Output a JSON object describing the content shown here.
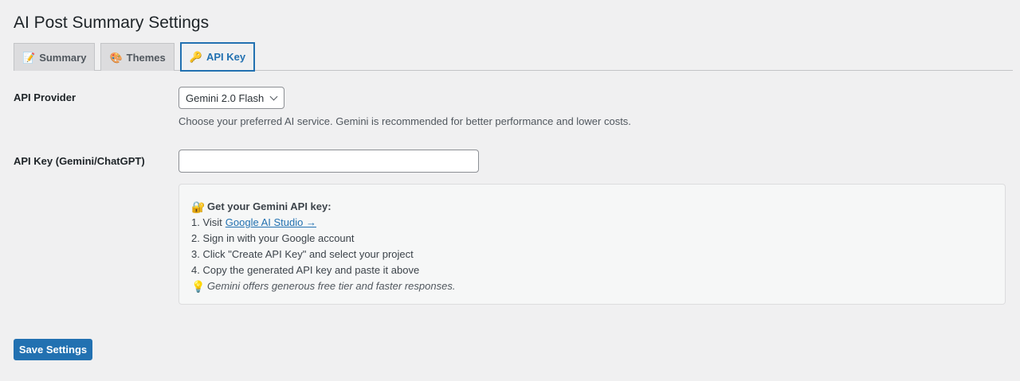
{
  "page": {
    "title": "AI Post Summary Settings"
  },
  "tabs": [
    {
      "label": "Summary",
      "icon": "📝",
      "icon_name": "memo-icon",
      "active": false
    },
    {
      "label": "Themes",
      "icon": "🎨",
      "icon_name": "palette-icon",
      "active": false
    },
    {
      "label": "API Key",
      "icon": "🔑",
      "icon_name": "key-icon",
      "active": true
    }
  ],
  "form": {
    "provider": {
      "label": "API Provider",
      "selected": "Gemini 2.0 Flash",
      "description": "Choose your preferred AI service. Gemini is recommended for better performance and lower costs."
    },
    "api_key": {
      "label": "API Key (Gemini/ChatGPT)",
      "value": "",
      "placeholder": ""
    }
  },
  "help": {
    "title_icon": "🔐",
    "title": "Get your Gemini API key:",
    "step1_prefix": "1. Visit",
    "step1_link": "Google AI Studio →",
    "step2": "2. Sign in with your Google account",
    "step3": "3. Click \"Create API Key\" and select your project",
    "step4": "4. Copy the generated API key and paste it above",
    "note_icon": "💡",
    "note": "Gemini offers generous free tier and faster responses."
  },
  "actions": {
    "save_label": "Save Settings"
  },
  "colors": {
    "accent": "#2271b1",
    "background": "#f0f0f1"
  }
}
